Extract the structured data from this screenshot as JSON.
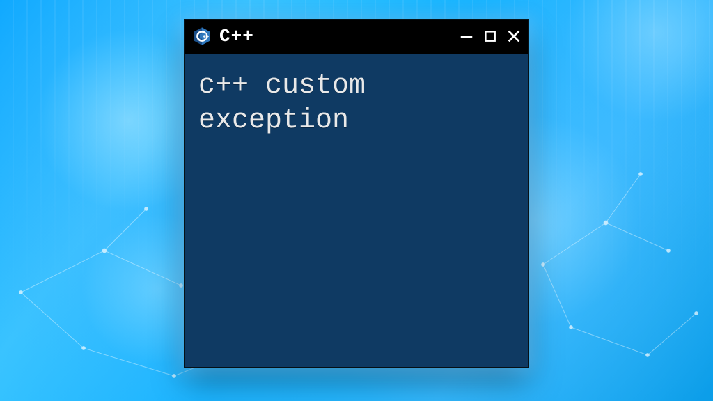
{
  "window": {
    "title": "C++",
    "content": "c++ custom\nexception",
    "icons": {
      "logo": "cpp-logo-icon",
      "minimize": "minimize-icon",
      "maximize": "maximize-icon",
      "close": "close-icon"
    }
  },
  "colors": {
    "titlebar": "#000000",
    "client_bg": "#0f3a63",
    "text": "#e9e9e9",
    "accent": "#1791d0"
  }
}
